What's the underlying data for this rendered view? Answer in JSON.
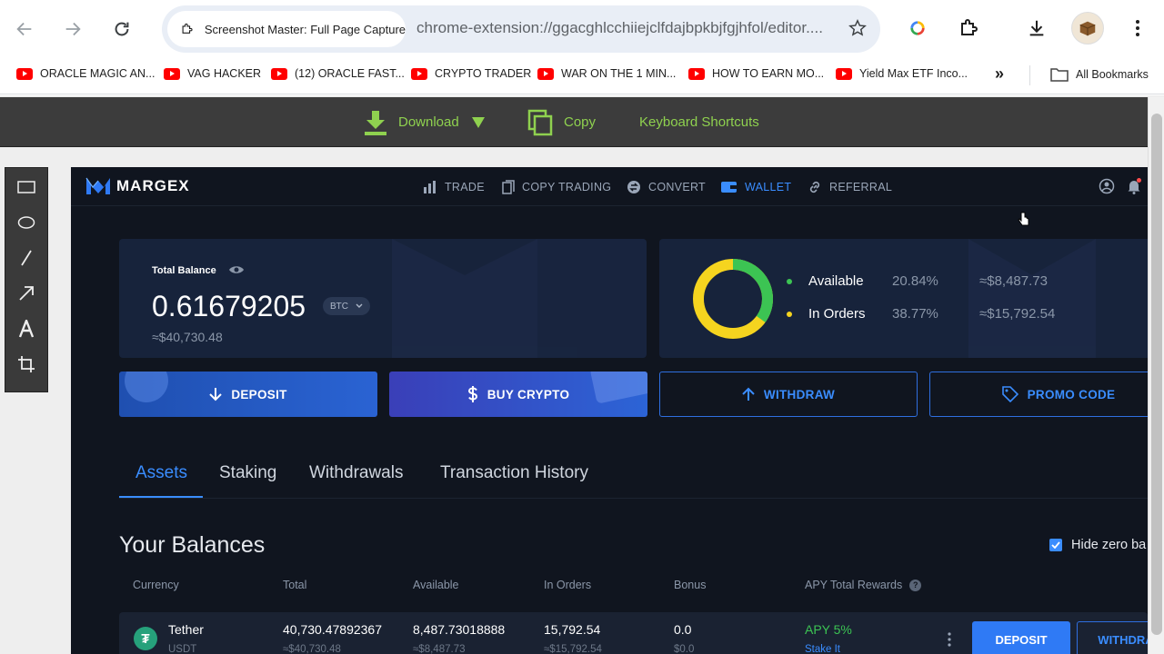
{
  "browser": {
    "extension_tab_label": "Screenshot Master: Full Page Capture",
    "url": "chrome-extension://ggacghlcchiiejclfdajbpkbjfgjhfol/editor....",
    "bookmarks": [
      "ORACLE MAGIC AN...",
      "VAG HACKER",
      "(12) ORACLE FAST...",
      "CRYPTO TRADER",
      "WAR ON THE 1 MIN...",
      "HOW TO EARN MO...",
      "Yield Max ETF Inco..."
    ],
    "overflow_label": "»",
    "all_bookmarks": "All Bookmarks"
  },
  "editor_toolbar": {
    "download": "Download",
    "copy": "Copy",
    "shortcuts": "Keyboard Shortcuts",
    "accent_color": "#8fd14f"
  },
  "left_tools": [
    "rectangle-tool",
    "ellipse-tool",
    "line-tool",
    "arrow-tool",
    "text-tool",
    "crop-tool"
  ],
  "app": {
    "brand": "MARGEX",
    "nav": [
      {
        "label": "TRADE",
        "icon": "bar-chart-icon"
      },
      {
        "label": "COPY TRADING",
        "icon": "copy-icon"
      },
      {
        "label": "CONVERT",
        "icon": "convert-icon"
      },
      {
        "label": "WALLET",
        "icon": "wallet-icon",
        "active": true
      },
      {
        "label": "REFERRAL",
        "icon": "link-icon"
      }
    ],
    "balance": {
      "label": "Total Balance",
      "value": "0.61679205",
      "currency": "BTC",
      "usd": "≈$40,730.48"
    },
    "allocation": {
      "available": {
        "label": "Available",
        "pct": "20.84%",
        "usd": "≈$8,487.73",
        "color": "#3cc453"
      },
      "in_orders": {
        "label": "In Orders",
        "pct": "38.77%",
        "usd": "≈$15,792.54",
        "color": "#f5d41f"
      }
    },
    "actions": {
      "deposit": "DEPOSIT",
      "buy": "BUY CRYPTO",
      "withdraw": "WITHDRAW",
      "promo": "PROMO CODE"
    },
    "tabs": [
      "Assets",
      "Staking",
      "Withdrawals",
      "Transaction History"
    ],
    "balances_title": "Your Balances",
    "hide_zero": "Hide zero ba",
    "columns": [
      "Currency",
      "Total",
      "Available",
      "In Orders",
      "Bonus",
      "APY Total Rewards"
    ],
    "rows": [
      {
        "name": "Tether",
        "ticker": "USDT",
        "total": "40,730.47892367",
        "total_usd": "≈$40,730.48",
        "available": "8,487.73018888",
        "available_usd": "≈$8,487.73",
        "in_orders": "15,792.54",
        "in_orders_usd": "≈$15,792.54",
        "bonus": "0.0",
        "bonus_usd": "$0.0",
        "apy": "APY 5%",
        "stake": "Stake It",
        "deposit": "DEPOSIT",
        "withdraw": "WITHDRA"
      }
    ]
  }
}
